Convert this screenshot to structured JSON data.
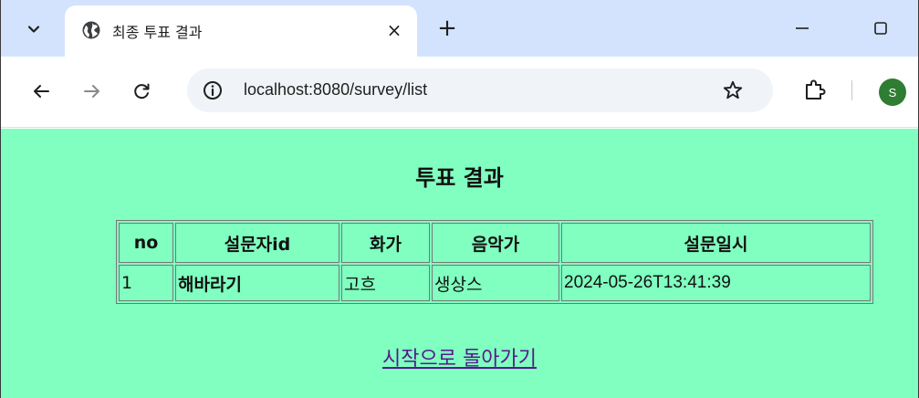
{
  "browser": {
    "tab_title": "최종 투표 결과",
    "tab_close": "×",
    "new_tab": "+",
    "url": "localhost:8080/survey/list",
    "profile_initial": "S"
  },
  "colors": {
    "page_background": "#80ffc0",
    "tab_strip": "#d3e3fd",
    "link_name": "#0000ff",
    "link_visited": "#551a8b",
    "avatar": "#2e7d32"
  },
  "page": {
    "title": "투표 결과",
    "table": {
      "headers": [
        "no",
        "설문자id",
        "화가",
        "음악가",
        "설문일시"
      ],
      "rows": [
        {
          "no": "1",
          "name": "해바라기",
          "painter": "고흐",
          "musician": "생상스",
          "datetime": "2024-05-26T13:41:39"
        }
      ]
    },
    "back_link": "시작으로 돌아가기"
  }
}
